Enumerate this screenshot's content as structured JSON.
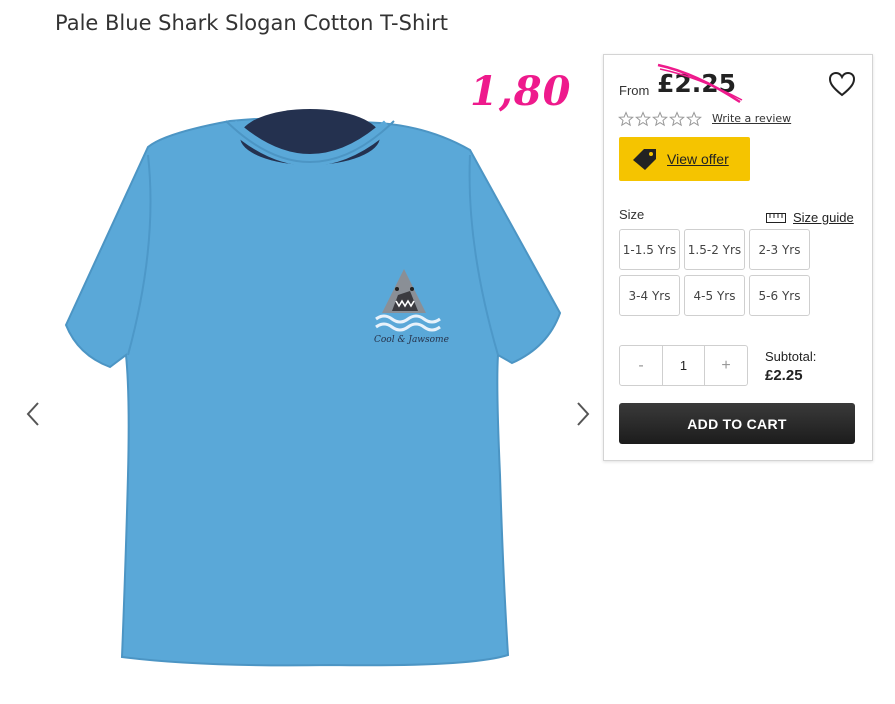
{
  "product": {
    "title": "Pale Blue Shark Slogan Cotton T-Shirt"
  },
  "gallery": {
    "image_name": "pale-blue-shark-tshirt",
    "print_text": "Cool & Jawsome",
    "shirt_color": "#5aa8d8"
  },
  "annotation": {
    "handwritten_price": "1,80",
    "color": "#ee1a8c"
  },
  "pricing": {
    "from_label": "From",
    "price": "£2.25"
  },
  "reviews": {
    "rating": 0,
    "max": 5,
    "write_label": "Write a review"
  },
  "offer": {
    "label": "View offer",
    "color": "#f5c400"
  },
  "size": {
    "label": "Size",
    "guide_label": "Size guide",
    "options": [
      "1-1.5 Yrs",
      "1.5-2 Yrs",
      "2-3 Yrs",
      "3-4 Yrs",
      "4-5 Yrs",
      "5-6 Yrs"
    ]
  },
  "quantity": {
    "minus": "-",
    "value": "1",
    "plus": "+"
  },
  "subtotal": {
    "label": "Subtotal:",
    "value": "£2.25"
  },
  "cart": {
    "label": "ADD TO CART"
  }
}
